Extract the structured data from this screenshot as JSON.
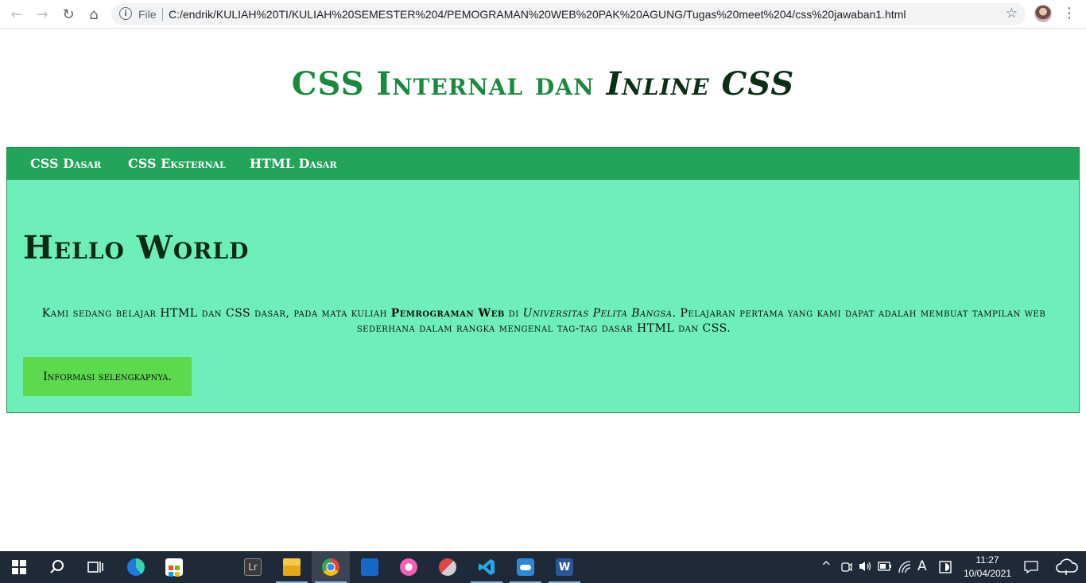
{
  "browser": {
    "scheme_label": "File",
    "url": "C:/endrik/KULIAH%20TI/KULIAH%20SEMESTER%204/PEMOGRAMAN%20WEB%20PAK%20AGUNG/Tugas%20meet%204/css%20jawaban1.html",
    "back_icon": "←",
    "forward_icon": "→",
    "reload_icon": "↻",
    "home_icon": "⌂",
    "info_icon": "i",
    "star_icon": "☆",
    "menu_icon": "⋮"
  },
  "page": {
    "title_part1": "CSS Internal dan ",
    "title_part2": "Inline CSS",
    "nav": [
      "CSS Dasar",
      "CSS Eksternal",
      "HTML Dasar"
    ],
    "heading": "Hello World",
    "para": {
      "t1": "Kami sedang belajar HTML dan CSS dasar, pada mata kuliah ",
      "strong": "Pemrograman Web",
      "t2": " di ",
      "em": "Universitas Pelita Bangsa",
      "t3": ". Pelajaran pertama yang kami dapat adalah membuat tampilan web sederhana dalam rangka mengenal tag-tag dasar HTML dan CSS."
    },
    "button": "Informasi selengkapnya."
  },
  "taskbar": {
    "time": "11:27",
    "date": "10/04/2021",
    "lr_label": "Lr",
    "lang_glyph": "A",
    "tray_chevron": "^"
  },
  "colors": {
    "title_green": "#1b8a3e",
    "title_dark": "#0b2f15",
    "navbar": "#22a55a",
    "content_bg": "#6eefba",
    "button_bg": "#5dd94e",
    "taskbar": "#1f2a38"
  }
}
